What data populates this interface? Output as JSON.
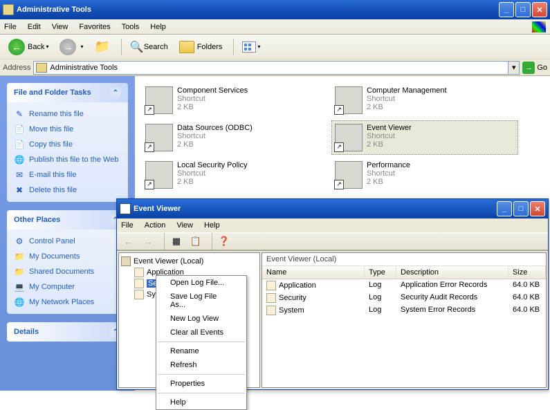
{
  "window": {
    "title": "Administrative Tools",
    "menu": [
      "File",
      "Edit",
      "View",
      "Favorites",
      "Tools",
      "Help"
    ],
    "toolbar": {
      "back": "Back",
      "search": "Search",
      "folders": "Folders"
    },
    "address_label": "Address",
    "address_value": "Administrative Tools",
    "go": "Go"
  },
  "tasks": {
    "file_folder": {
      "title": "File and Folder Tasks",
      "items": [
        {
          "icon": "✎",
          "label": "Rename this file"
        },
        {
          "icon": "📄",
          "label": "Move this file"
        },
        {
          "icon": "📄",
          "label": "Copy this file"
        },
        {
          "icon": "🌐",
          "label": "Publish this file to the Web"
        },
        {
          "icon": "✉",
          "label": "E-mail this file"
        },
        {
          "icon": "✖",
          "label": "Delete this file"
        }
      ]
    },
    "other": {
      "title": "Other Places",
      "items": [
        {
          "icon": "⚙",
          "label": "Control Panel"
        },
        {
          "icon": "📁",
          "label": "My Documents"
        },
        {
          "icon": "📁",
          "label": "Shared Documents"
        },
        {
          "icon": "💻",
          "label": "My Computer"
        },
        {
          "icon": "🌐",
          "label": "My Network Places"
        }
      ]
    },
    "details": {
      "title": "Details"
    }
  },
  "files": [
    [
      {
        "name": "Component Services",
        "type": "Shortcut",
        "size": "2 KB",
        "sel": false
      },
      {
        "name": "Computer Management",
        "type": "Shortcut",
        "size": "2 KB",
        "sel": false
      }
    ],
    [
      {
        "name": "Data Sources (ODBC)",
        "type": "Shortcut",
        "size": "2 KB",
        "sel": false
      },
      {
        "name": "Event Viewer",
        "type": "Shortcut",
        "size": "2 KB",
        "sel": true
      }
    ],
    [
      {
        "name": "Local Security Policy",
        "type": "Shortcut",
        "size": "2 KB",
        "sel": false
      },
      {
        "name": "Performance",
        "type": "Shortcut",
        "size": "2 KB",
        "sel": false
      }
    ]
  ],
  "ev": {
    "title": "Event Viewer",
    "menu": [
      "File",
      "Action",
      "View",
      "Help"
    ],
    "tree_root": "Event Viewer (Local)",
    "tree": [
      {
        "label": "Application",
        "sel": false
      },
      {
        "label": "Security",
        "sel": true
      },
      {
        "label": "System",
        "sel": false
      }
    ],
    "list_title": "Event Viewer (Local)",
    "cols": [
      "Name",
      "Type",
      "Description",
      "Size"
    ],
    "rows": [
      {
        "name": "Application",
        "type": "Log",
        "desc": "Application Error Records",
        "size": "64.0 KB"
      },
      {
        "name": "Security",
        "type": "Log",
        "desc": "Security Audit Records",
        "size": "64.0 KB"
      },
      {
        "name": "System",
        "type": "Log",
        "desc": "System Error Records",
        "size": "64.0 KB"
      }
    ]
  },
  "ctx": [
    "Open Log File...",
    "Save Log File As...",
    "New Log View",
    "Clear all Events",
    "-",
    "Rename",
    "Refresh",
    "-",
    "Properties",
    "-",
    "Help"
  ]
}
